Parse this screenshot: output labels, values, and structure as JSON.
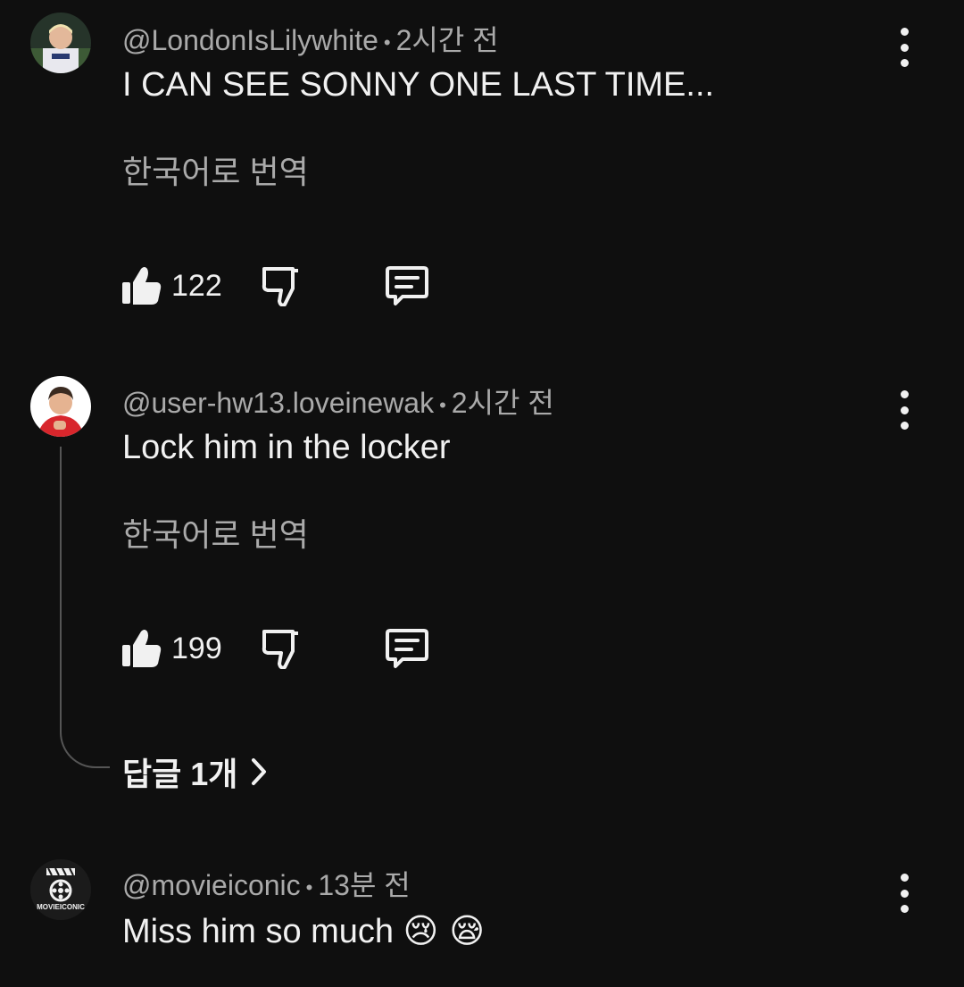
{
  "comments": [
    {
      "handle": "@LondonIsLilywhite",
      "time": "2시간 전",
      "text": "I CAN SEE SONNY ONE LAST TIME...",
      "translate": "한국어로 번역",
      "likes": "122"
    },
    {
      "handle": "@user-hw13.loveinewak",
      "time": "2시간 전",
      "text": "Lock him in the locker",
      "translate": "한국어로 번역",
      "likes": "199",
      "replies_label": "답글 1개"
    },
    {
      "handle": "@movieiconic",
      "time": "13분 전",
      "text": "Miss him so much",
      "emojis": "😢 😪",
      "avatar_text": "MOVIEICONIC"
    }
  ],
  "separator": "•",
  "icons": {
    "like": "thumbs-up-icon",
    "dislike": "thumbs-down-icon",
    "reply": "comment-icon",
    "more": "more-vertical-icon",
    "replies_chevron": "chevron-right-icon"
  },
  "colors": {
    "background": "#0f0f0f",
    "primary_text": "#f1f1f1",
    "secondary_text": "#aaaaaa",
    "thread_line": "#555555"
  }
}
